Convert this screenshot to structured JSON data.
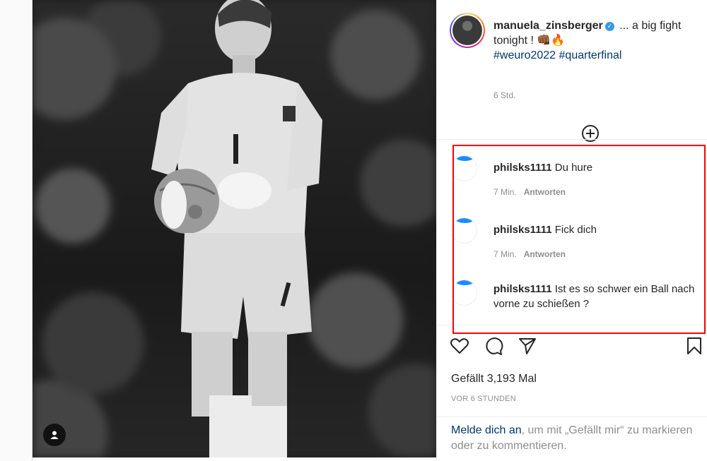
{
  "post": {
    "username": "manuela_zinsberger",
    "caption_text": "... a big fight tonight ! 👊🏾🔥",
    "hashtags": "#weuro2022 #quarterfinal",
    "time": "6 Std.",
    "likes": "Gefällt 3,193 Mal",
    "posted_ago": "VOR 6 STUNDEN"
  },
  "comments": [
    {
      "user": "philsks1111",
      "text": "Du hure",
      "time": "7 Min.",
      "reply": "Antworten"
    },
    {
      "user": "philsks1111",
      "text": "Fick dich",
      "time": "7 Min.",
      "reply": "Antworten"
    },
    {
      "user": "philsks1111",
      "text": "Ist es so schwer ein Ball nach vorne zu schießen ?"
    }
  ],
  "login_prompt": {
    "link": "Melde dich an",
    "rest": ", um mit „Gefällt mir“ zu markieren oder zu kommentieren."
  },
  "colors": {
    "link": "#00376b",
    "muted": "#8e8e8e",
    "verified": "#3897f0",
    "highlight": "#ff0000"
  },
  "icons": [
    "user-tag-icon",
    "verified-badge-icon",
    "plus-circle-icon",
    "heart-icon",
    "comment-icon",
    "share-icon",
    "bookmark-icon"
  ]
}
